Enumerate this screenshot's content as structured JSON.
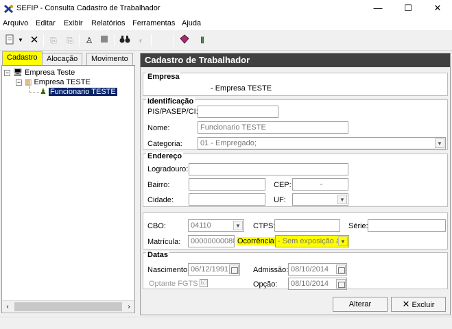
{
  "window": {
    "title": "SEFIP - Consulta Cadastro de Trabalhador",
    "minimize": "—",
    "maximize": "☐",
    "close": "✕"
  },
  "menu": [
    "Arquivo",
    "Editar",
    "Exibir",
    "Relatórios",
    "Ferramentas",
    "Ajuda"
  ],
  "toolbar": {
    "icons": [
      "new-document-icon",
      "dropdown-arrow-icon",
      "delete-x-icon",
      "copy-icon",
      "paste-icon",
      "user-icon",
      "stop-icon",
      "binoculars-icon",
      "disabled-icon",
      "gem-icon",
      "columns-icon"
    ]
  },
  "tabs": [
    "Cadastro",
    "Alocação",
    "Movimento"
  ],
  "tree": {
    "root": "Empresa Teste",
    "company": "Empresa TESTE",
    "worker": "Funcionario TESTE"
  },
  "panel": {
    "title": "Cadastro de Trabalhador",
    "empresa": {
      "title": "Empresa",
      "value": "-  Empresa TESTE"
    },
    "identificacao": {
      "title": "Identificação",
      "pis_label": "PIS/PASEP/CI:",
      "pis_value": "",
      "nome_label": "Nome:",
      "nome_value": "Funcionario TESTE",
      "categoria_label": "Categoria:",
      "categoria_value": "01 - Empregado;"
    },
    "endereco": {
      "title": "Endereço",
      "logradouro_label": "Logradouro:",
      "logradouro_value": "",
      "bairro_label": "Bairro:",
      "bairro_value": "",
      "cep_label": "CEP:",
      "cep_value": "-",
      "cidade_label": "Cidade:",
      "cidade_value": "",
      "uf_label": "UF:",
      "uf_value": ""
    },
    "trabalho": {
      "cbo_label": "CBO:",
      "cbo_value": "04110",
      "ctps_label": "CTPS:",
      "ctps_value": "",
      "serie_label": "Série:",
      "serie_value": "",
      "matricula_label": "Matrícula:",
      "matricula_value": "00000000080",
      "ocorrencia_label": "Ocorrência:",
      "ocorrencia_value": "- Sem exposição a"
    },
    "datas": {
      "title": "Datas",
      "nascimento_label": "Nascimento:",
      "nascimento_value": "06/12/1991",
      "admissao_label": "Admissão:",
      "admissao_value": "08/10/2014",
      "optante_label": "Optante FGTS",
      "optante_checked": "☑",
      "opcao_label": "Opção:",
      "opcao_value": "08/10/2014"
    },
    "buttons": {
      "alterar": "Alterar",
      "excluir": "Excluir"
    }
  },
  "colors": {
    "highlight": "#ffff00",
    "header_bg": "#404040",
    "selection": "#0a246a"
  }
}
